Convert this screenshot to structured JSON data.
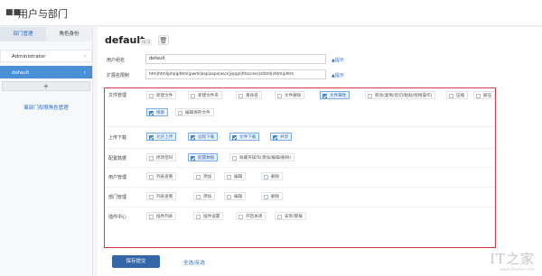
{
  "titlebar": {
    "icon": "users-icon",
    "title": "用户与部门"
  },
  "sidebar": {
    "tabs": [
      "部门管理",
      "角色身份"
    ],
    "items": [
      {
        "label": "Administrator",
        "active": false
      },
      {
        "label": "default",
        "active": true
      }
    ],
    "add_label": "+",
    "bottom_link": "离部门权限角色管理"
  },
  "role": {
    "name": "default",
    "id_badge": "id:2",
    "delete_icon": "trash-icon"
  },
  "form": {
    "name_label": "用户组名",
    "name_value": "default",
    "name_hint": "提示",
    "ext_label": "扩展名限制",
    "ext_value": "htm|html|php|phtml|pwml|asp|aspx|ascx|jsp|cfm|cfc|pl|bat|exe|com|dll|vbs|js|reg|cgi|htaccess|asis|sh|shtml|shtm|phtm",
    "ext_value_visible": "htm|html|php|phtml|pwml|asp|aspx|ascx|jsp|pl|htaccess|shtml|shtm|phtm",
    "ext_hint": "提示"
  },
  "permissions": [
    {
      "label": "文件管理",
      "options": [
        {
          "label": "新建文件",
          "checked": false
        },
        {
          "label": "新建文件夹",
          "checked": false
        },
        {
          "label": "重命名",
          "checked": false
        },
        {
          "label": "文件删除",
          "checked": false
        },
        {
          "label": "文件属性",
          "checked": true
        },
        {
          "label": "移动(复制/剪切/粘贴/拖拽操作)",
          "checked": false
        },
        {
          "label": "压缩",
          "checked": false
        },
        {
          "label": "解压",
          "checked": false
        },
        {
          "label": "搜索",
          "checked": true
        },
        {
          "label": "编辑保存文件",
          "checked": false
        }
      ]
    },
    {
      "label": "上传下载",
      "options": [
        {
          "label": "允许上传",
          "checked": true
        },
        {
          "label": "远程下载",
          "checked": true
        },
        {
          "label": "文件下载",
          "checked": true
        },
        {
          "label": "共享",
          "checked": true
        }
      ]
    },
    {
      "label": "配置数据",
      "options": [
        {
          "label": "修改密码",
          "checked": false
        },
        {
          "label": "配置数据",
          "checked": true
        },
        {
          "label": "收藏夹操作(添加/编辑/删除)",
          "checked": false
        }
      ]
    },
    {
      "label": "用户管理",
      "options": [
        {
          "label": "列表查看",
          "checked": false
        },
        {
          "label": "添加",
          "checked": false
        },
        {
          "label": "编辑",
          "checked": false
        },
        {
          "label": "删除",
          "checked": false
        }
      ]
    },
    {
      "label": "部门管理",
      "options": [
        {
          "label": "列表查看",
          "checked": false
        },
        {
          "label": "添加",
          "checked": false
        },
        {
          "label": "编辑",
          "checked": false
        },
        {
          "label": "删除",
          "checked": false
        }
      ]
    },
    {
      "label": "插件中心",
      "options": [
        {
          "label": "插件列表",
          "checked": false
        },
        {
          "label": "插件设置",
          "checked": false
        },
        {
          "label": "开启关闭",
          "checked": false
        },
        {
          "label": "安装/卸载",
          "checked": false
        }
      ]
    }
  ],
  "actions": {
    "save": "保存提交",
    "select_all": "全选/反选"
  },
  "watermark": {
    "logo": "IT之家",
    "url": "www.ithome.com"
  },
  "colors": {
    "accent": "#3466a8",
    "highlight": "#d93a44",
    "active_item": "#4a90d9"
  }
}
